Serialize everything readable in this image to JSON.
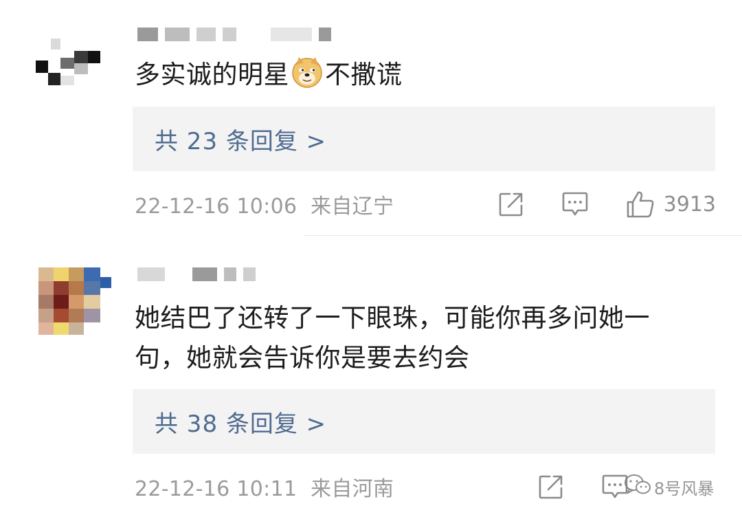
{
  "comments": [
    {
      "text_before_emoji": "多实诚的明星",
      "emoji": "doge-emoji",
      "text_after_emoji": "不撒谎",
      "reply_label": "共 23 条回复 >",
      "time": "22-12-16 10:06",
      "location": "来自辽宁",
      "likes": "3913"
    },
    {
      "text_line1": "她结巴了还转了一下眼珠，可能你再多问她一",
      "text_line2": "句，她就会告诉你是要去约会",
      "reply_label": "共 38 条回复 >",
      "time": "22-12-16 10:11",
      "location": "来自河南"
    }
  ],
  "icons": {
    "share": "share-icon",
    "comment": "comment-icon",
    "like": "thumbs-up-icon"
  },
  "watermark": {
    "text": "8号风暴"
  },
  "colors": {
    "reply_link": "#4f6b91",
    "meta_gray": "#9a9a9a",
    "reply_bg": "#f3f3f3"
  }
}
